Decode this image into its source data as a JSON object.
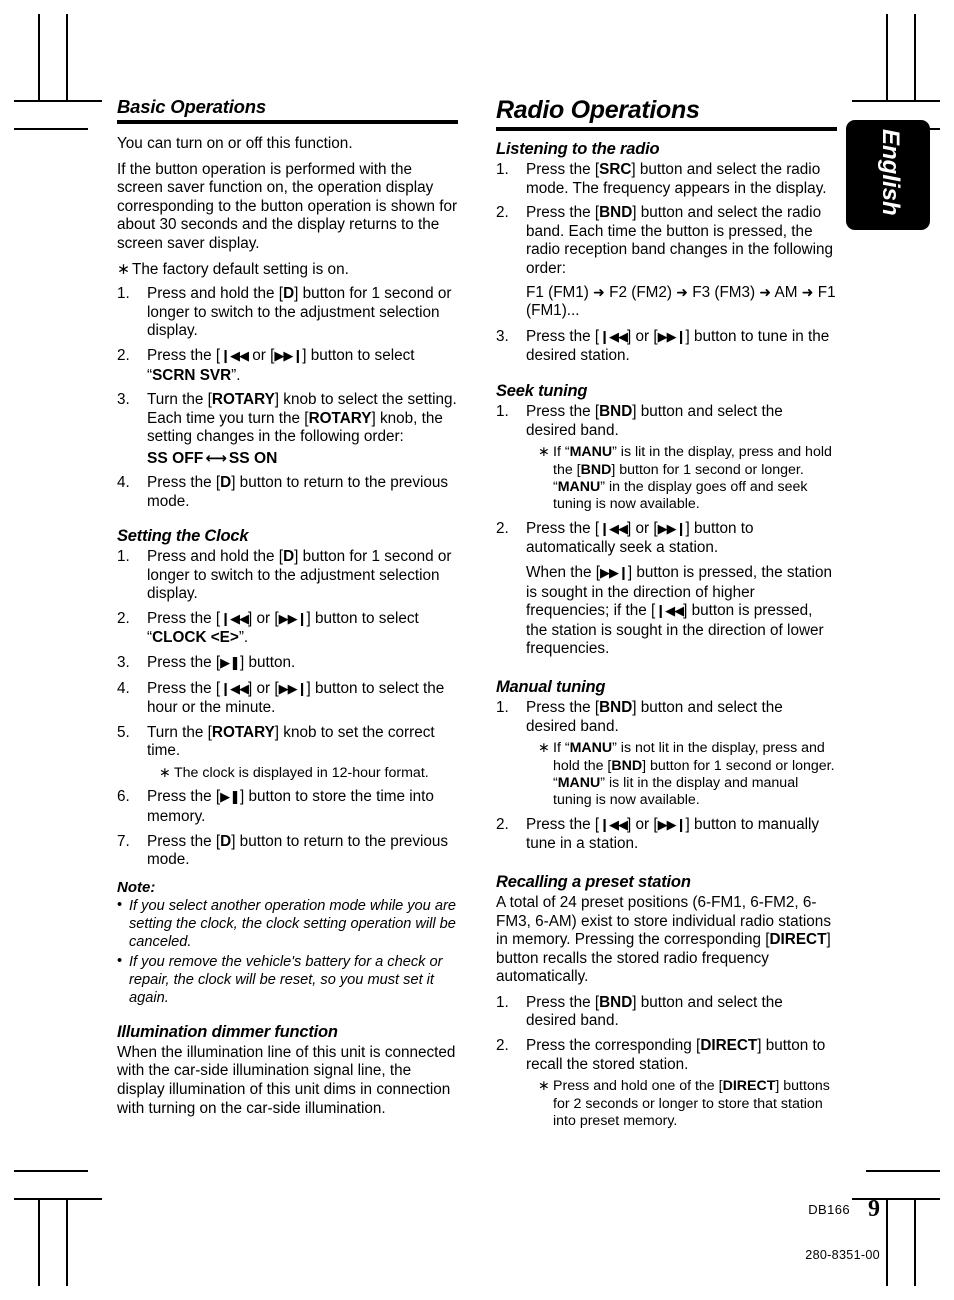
{
  "page": {
    "language_tab": "English",
    "footer_model": "DB166",
    "footer_page_number": "9",
    "footer_code": "280-8351-00"
  },
  "left_column": {
    "heading": "Basic Operations",
    "intro_1": "You can turn on or off this function.",
    "intro_2": "If the button operation is performed with the screen saver function on, the operation display corresponding to the button operation is shown for about 30 seconds and the display returns to the screen saver display.",
    "note_factory": "The factory default setting is on.",
    "steps": [
      {
        "num": "1.",
        "pre": "Press and hold the [",
        "b1": "D",
        "post": "] button for 1 second or longer to switch to the adjustment selection display."
      },
      {
        "num": "2.",
        "pre": "Press the [",
        "post": "] button to select “",
        "b2": "SCRN SVR",
        "tail": "”."
      },
      {
        "num": "3.",
        "pre": "Turn the [",
        "b1": "ROTARY",
        "mid": "] knob to select the setting. Each time you turn the [",
        "b2": "ROTARY",
        "post": "] knob, the setting changes in the following order:"
      },
      {
        "num": "4.",
        "pre": "Press the [",
        "b1": "D",
        "post": "] button to return to the previous mode."
      }
    ],
    "ss_sequence_left": "SS OFF",
    "ss_sequence_right": "SS ON",
    "clock_heading": "Setting the Clock",
    "clock_steps": [
      {
        "num": "1.",
        "text": "Press and hold the [D] button for 1 second or longer to switch to the adjustment selection display."
      },
      {
        "num": "2.",
        "text": "Press the [|◀◀] or [▶▶|] button to select “CLOCK <E>”."
      },
      {
        "num": "3.",
        "text": "Press the [▶❙❙] button."
      },
      {
        "num": "4.",
        "text": "Press the [|◀◀] or [▶▶|] button to select the hour or the minute."
      },
      {
        "num": "5.",
        "text": "Turn the [ROTARY] knob to set the correct time."
      },
      {
        "num": "6.",
        "text": "Press the [▶❙❙] button to store the time into memory."
      },
      {
        "num": "7.",
        "text": "Press the [D] button to return to the previous mode."
      }
    ],
    "clock_note_12hour": "The clock is displayed in 12-hour format.",
    "clock_select_label": "CLOCK <E>",
    "note_heading": "Note:",
    "notes": [
      "If you select another operation mode while you are setting the clock, the clock setting operation will be canceled.",
      "If you remove the vehicle's battery for a check or repair, the clock will be reset, so you must set it again."
    ],
    "illumination_heading": "Illumination dimmer function",
    "illumination_body": "When the illumination line of this unit is connected with the car-side illumination signal line, the display illumination of this unit dims in connection with turning on the car-side illumination."
  },
  "right_column": {
    "heading": "Radio Operations",
    "listening_heading": "Listening to the radio",
    "listening_step1_pre": "Press the [",
    "listening_step1_btn": "SRC",
    "listening_step1_post": "] button and select the radio mode. The frequency appears in the display.",
    "listening_step2_pre": "Press the [",
    "listening_step2_btn": "BND",
    "listening_step2_post": "] button and select the radio band. Each time the button is pressed, the radio reception band changes in the following order:",
    "band_sequence": [
      "F1 (FM1)",
      "F2 (FM2)",
      "F3 (FM3)",
      "AM",
      "F1 (FM1)..."
    ],
    "listening_step3_post": "] button to tune in the desired station.",
    "seek_heading": "Seek tuning",
    "seek_step1_pre": "Press the [",
    "seek_step1_btn": "BND",
    "seek_step1_post": "] button and select the desired band.",
    "seek_note_a": "If “",
    "seek_note_manu": "MANU",
    "seek_note_b": "” is lit in the display, press and hold the [",
    "seek_note_bnd": "BND",
    "seek_note_c": "] button for 1 second or longer. “",
    "seek_note_manu2": "MANU",
    "seek_note_d": "”  in the display goes off and seek tuning is now available.",
    "seek_step2_post": "] button to automatically seek a station.",
    "seek_detail_a": "When the [",
    "seek_detail_b": "] button is pressed, the station is sought in the direction of higher frequencies; if the [",
    "seek_detail_c": "] button is pressed, the station is sought in the direction of lower frequencies.",
    "manual_heading": "Manual tuning",
    "manual_step1_pre": "Press the [",
    "manual_step1_btn": "BND",
    "manual_step1_post": "] button and select the desired band.",
    "manual_note_a": "If “",
    "manual_note_manu": "MANU",
    "manual_note_b": "” is not lit in the display, press and hold the [",
    "manual_note_bnd": "BND",
    "manual_note_c": "] button for 1 second or longer. “",
    "manual_note_manu2": "MANU",
    "manual_note_d": "” is lit in the display and manual tuning is now available.",
    "manual_step2_post": "] button to manually tune in a station.",
    "preset_heading": "Recalling a preset station",
    "preset_intro_a": "A total of 24 preset positions (6-FM1, 6-FM2, 6-FM3, 6-AM) exist to store individual radio stations in memory. Pressing the corresponding [",
    "preset_intro_btn": "DIRECT",
    "preset_intro_b": "] button recalls the stored radio frequency automatically.",
    "preset_step1_pre": "Press the [",
    "preset_step1_btn": "BND",
    "preset_step1_post": "] button and select the desired band.",
    "preset_step2_pre": "Press the corresponding [",
    "preset_step2_btn": "DIRECT",
    "preset_step2_post": "] button to recall the stored station.",
    "preset_note_a": "Press and hold one of the [",
    "preset_note_btn": "DIRECT",
    "preset_note_b": "] buttons for 2 seconds or longer to store that station into preset memory."
  },
  "labels": {
    "or": " or ",
    "press_the": "Press the [",
    "close_bracket": "]",
    "asterisk": "∗",
    "bullet": "•"
  }
}
